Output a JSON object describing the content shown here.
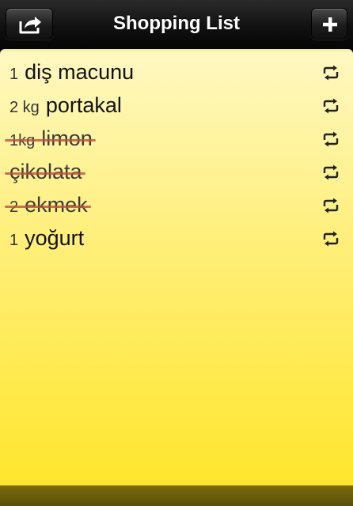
{
  "header": {
    "title": "Shopping List",
    "share_icon": "share-icon",
    "add_icon": "plus-icon"
  },
  "items": [
    {
      "qty": "1",
      "name": "diş macunu",
      "crossed": false,
      "icon": "repeat-icon"
    },
    {
      "qty": "2 kg",
      "name": "portakal",
      "crossed": false,
      "icon": "repeat-icon"
    },
    {
      "qty": "1kg",
      "name": "limon",
      "crossed": true,
      "icon": "repeat-icon"
    },
    {
      "qty": "",
      "name": "çikolata",
      "crossed": true,
      "icon": "repeat-icon"
    },
    {
      "qty": "2",
      "name": "ekmek",
      "crossed": true,
      "icon": "repeat-icon"
    },
    {
      "qty": "1",
      "name": "yoğurt",
      "crossed": false,
      "icon": "repeat-icon"
    }
  ],
  "colors": {
    "pad_top": "#fff8c2",
    "pad_bottom": "#ffe62d",
    "strike": "#be503c",
    "navbar": "#111111"
  }
}
